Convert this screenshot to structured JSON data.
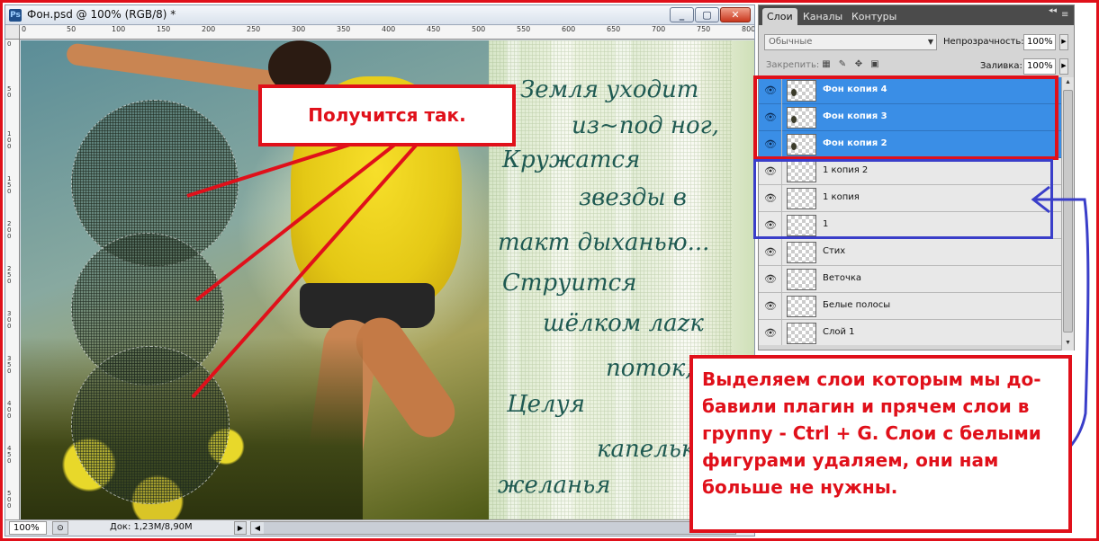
{
  "document": {
    "title": "Фон.psd @ 100% (RGB/8) *",
    "app_icon": "Ps",
    "window_buttons": {
      "minimize": "_",
      "maximize": "▢",
      "close": "✕"
    },
    "ruler_top_ticks": [
      "0",
      "50",
      "100",
      "150",
      "200",
      "250",
      "300",
      "350",
      "400",
      "450",
      "500",
      "550",
      "600",
      "650",
      "700",
      "750",
      "800"
    ],
    "ruler_left_ticks": [
      "0",
      "50",
      "100",
      "150",
      "200",
      "250",
      "300",
      "350",
      "400",
      "450",
      "500"
    ],
    "zoom": "100%",
    "doc_size": "Док: 1,23M/8,90M",
    "poem_lines": [
      "Земля уходит",
      "из~под ног,",
      "Кружатся",
      "звезды в",
      "такт дыханью...",
      "Струится",
      "шёлком лаzк",
      "поток,",
      "Целуя",
      "капельк",
      "желанья"
    ]
  },
  "layers_panel": {
    "tabs": [
      "Слои",
      "Каналы",
      "Контуры"
    ],
    "active_tab": "Слои",
    "collapse_glyph": "◂◂",
    "menu_glyph": "≡",
    "blend_mode": "Обычные",
    "opacity_label": "Непрозрачность:",
    "opacity_value": "100%",
    "lock_label": "Закрепить:",
    "lock_icons": [
      "lock-transparent-icon",
      "lock-brush-icon",
      "lock-move-icon",
      "lock-all-icon"
    ],
    "fill_label": "Заливка:",
    "fill_value": "100%",
    "layers": [
      {
        "name": "Фон копия 4",
        "selected": true,
        "visible": true
      },
      {
        "name": "Фон копия 3",
        "selected": true,
        "visible": true
      },
      {
        "name": "Фон копия 2",
        "selected": true,
        "visible": true
      },
      {
        "name": "1 копия 2",
        "selected": false,
        "visible": true
      },
      {
        "name": "1 копия",
        "selected": false,
        "visible": true
      },
      {
        "name": "1",
        "selected": false,
        "visible": true
      },
      {
        "name": "Стих",
        "selected": false,
        "visible": true
      },
      {
        "name": "Веточка",
        "selected": false,
        "visible": true
      },
      {
        "name": "Белые полосы",
        "selected": false,
        "visible": true
      },
      {
        "name": "Слой 1",
        "selected": false,
        "visible": true
      }
    ]
  },
  "annotations": {
    "callout_top": "Получится так.",
    "callout_main_lines": [
      "Выделяем слои которым мы до-",
      "бавили плагин и прячем слои в",
      "группу - Ctrl + G. Слои с белыми",
      "фигурами удаляем, они нам",
      "больше не нужны."
    ]
  },
  "colors": {
    "annotation_red": "#e0101a",
    "annotation_blue": "#3a3ec9",
    "selection_blue": "#3a8ee6",
    "panel_gray": "#d5d5d5"
  }
}
